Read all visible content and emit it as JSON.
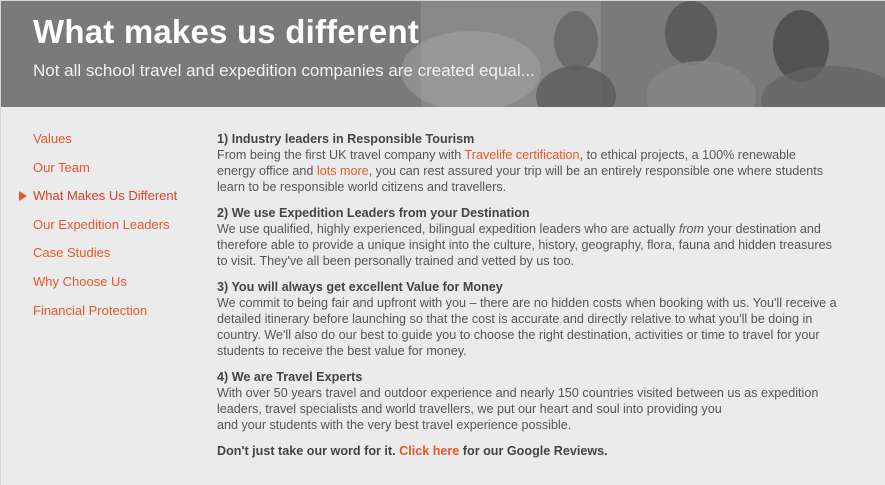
{
  "hero": {
    "title": "What makes us different",
    "subtitle": "Not all school travel and expedition companies are created equal..."
  },
  "sidebar": {
    "items": [
      {
        "label": "Values"
      },
      {
        "label": "Our Team"
      },
      {
        "label": "What Makes Us Different",
        "active": true
      },
      {
        "label": "Our Expedition Leaders"
      },
      {
        "label": "Case Studies"
      },
      {
        "label": "Why Choose Us"
      },
      {
        "label": "Financial Protection"
      }
    ]
  },
  "sections": [
    {
      "heading": "1) Industry leaders in Responsible Tourism",
      "p1": "From being the first UK travel company with ",
      "link1": "Travelife certification",
      "p2": ", to ethical projects, a 100% renewable energy office and ",
      "link2": "lots more",
      "p3": ", you can rest assured your trip will be an entirely responsible one where students learn to be responsible world citizens and travellers."
    },
    {
      "heading": "2) We use Expedition Leaders from your Destination",
      "p1": "We use qualified, highly experienced, bilingual expedition leaders who are actually ",
      "em": "from",
      "p2": " your destination and therefore able to provide a unique insight into the culture, history, geography, flora, fauna and hidden treasures to visit. They've all been personally trained and vetted by us too."
    },
    {
      "heading": "3) You will always get excellent Value for Money",
      "text": "We commit to being fair and upfront with you – there are no hidden costs when booking with us. You'll receive a detailed itinerary before launching so that the cost is accurate and directly relative to what you'll be doing in country. We'll also do our best to guide you to choose the right destination, activities or time to travel for your students to receive the best value for money."
    },
    {
      "heading": "4) We are Travel Experts",
      "line1": "With over 50 years travel and outdoor experience and nearly 150 countries visited between us as expedition leaders, travel specialists and world travellers, we put our heart and soul into providing you",
      "line2": "and your students with the very best travel experience possible."
    }
  ],
  "footer": {
    "pre": "Don't just take our word for it. ",
    "link": "Click here",
    "post": " for our Google Reviews."
  },
  "colors": {
    "accent": "#e8572a",
    "active": "#d4412a"
  }
}
